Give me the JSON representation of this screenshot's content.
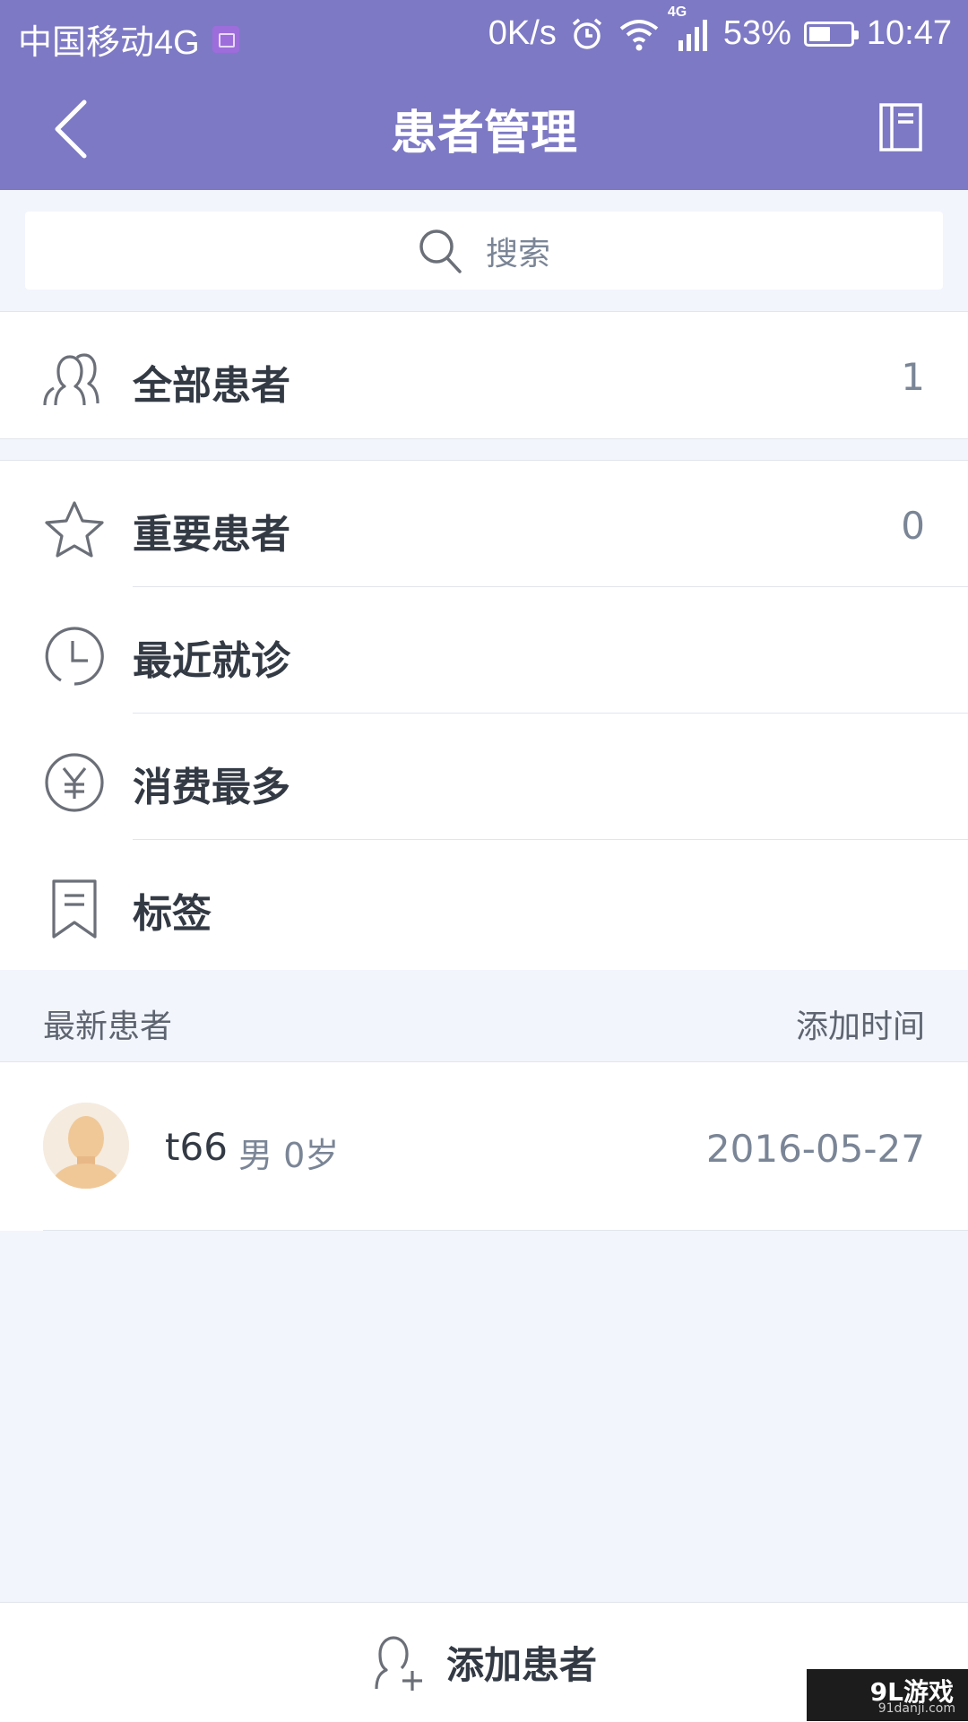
{
  "status_bar": {
    "carrier": "中国移动4G",
    "speed": "0K/s",
    "network": "4G",
    "battery_percent": "53%",
    "battery_level": 0.53,
    "time": "10:47"
  },
  "nav": {
    "title": "患者管理",
    "back_icon": "chevron-left-icon",
    "right_icon": "notebook-icon"
  },
  "search": {
    "placeholder": "搜索"
  },
  "all_patients": {
    "label": "全部患者",
    "count": "1",
    "icon": "users-icon"
  },
  "menu": {
    "items": [
      {
        "label": "重要患者",
        "count": "0",
        "icon": "star-icon"
      },
      {
        "label": "最近就诊",
        "count": "",
        "icon": "clock-icon"
      },
      {
        "label": "消费最多",
        "count": "",
        "icon": "yen-icon"
      },
      {
        "label": "标签",
        "count": "",
        "icon": "bookmark-icon"
      }
    ]
  },
  "latest": {
    "title": "最新患者",
    "sort_label": "添加时间",
    "patients": [
      {
        "name": "t66",
        "meta": "男 0岁",
        "date": "2016-05-27"
      }
    ]
  },
  "footer": {
    "add_label": "添加患者",
    "add_icon": "add-user-icon"
  },
  "watermark": {
    "main": "9L游戏",
    "sub": "91danji.com"
  },
  "colors": {
    "primary": "#7d79c4",
    "background": "#f2f5fc",
    "text": "#333a44",
    "secondary_text": "#7a8596",
    "icon": "#6b6f78"
  }
}
